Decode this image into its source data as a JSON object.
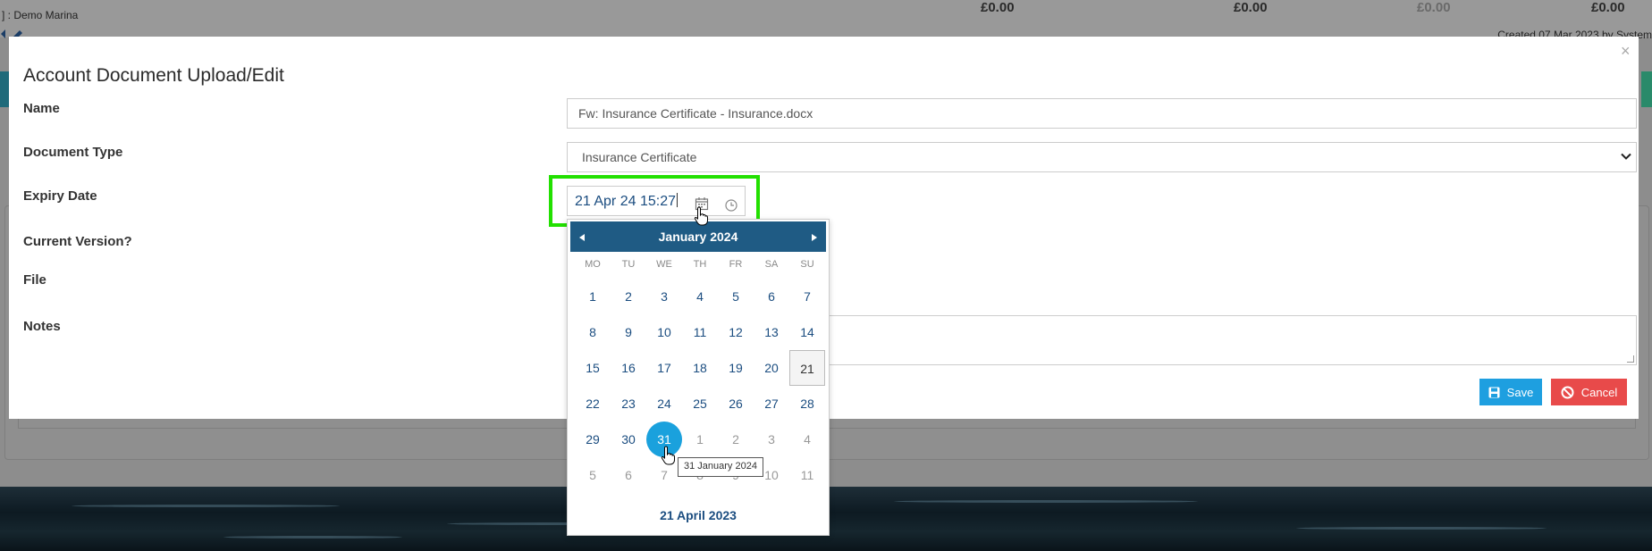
{
  "background": {
    "marina_label": "] : Demo Marina",
    "amounts": [
      "£0.00",
      "£0.00",
      "£0.00",
      "£0.00"
    ],
    "created_text": "Created 07 Mar 2023 by System"
  },
  "modal": {
    "title": "Account Document Upload/Edit",
    "close_symbol": "×",
    "labels": {
      "name": "Name",
      "document_type": "Document Type",
      "expiry_date": "Expiry Date",
      "current_version": "Current Version?",
      "file": "File",
      "notes": "Notes"
    },
    "name_value": "Fw: Insurance Certificate - Insurance.docx",
    "document_type_value": "Insurance Certificate",
    "expiry_value": "21 Apr 24 15:27",
    "save_label": "Save",
    "cancel_label": "Cancel",
    "accent_colors": {
      "save": "#1e9fe0",
      "cancel": "#e84a4a",
      "picker_header": "#1f5b84",
      "selected_day": "#1aa1dd",
      "highlight": "#22e000"
    }
  },
  "datepicker": {
    "month_label": "January 2024",
    "weekdays": [
      "MO",
      "TU",
      "WE",
      "TH",
      "FR",
      "SA",
      "SU"
    ],
    "weeks": [
      [
        {
          "d": "1"
        },
        {
          "d": "2"
        },
        {
          "d": "3"
        },
        {
          "d": "4"
        },
        {
          "d": "5"
        },
        {
          "d": "6"
        },
        {
          "d": "7"
        }
      ],
      [
        {
          "d": "8"
        },
        {
          "d": "9"
        },
        {
          "d": "10"
        },
        {
          "d": "11"
        },
        {
          "d": "12"
        },
        {
          "d": "13"
        },
        {
          "d": "14"
        }
      ],
      [
        {
          "d": "15"
        },
        {
          "d": "16"
        },
        {
          "d": "17"
        },
        {
          "d": "18"
        },
        {
          "d": "19"
        },
        {
          "d": "20"
        },
        {
          "d": "21",
          "state": "today"
        }
      ],
      [
        {
          "d": "22"
        },
        {
          "d": "23"
        },
        {
          "d": "24"
        },
        {
          "d": "25"
        },
        {
          "d": "26"
        },
        {
          "d": "27"
        },
        {
          "d": "28"
        }
      ],
      [
        {
          "d": "29"
        },
        {
          "d": "30"
        },
        {
          "d": "31",
          "state": "selected"
        },
        {
          "d": "1",
          "state": "muted"
        },
        {
          "d": "2",
          "state": "muted"
        },
        {
          "d": "3",
          "state": "muted"
        },
        {
          "d": "4",
          "state": "muted"
        }
      ],
      [
        {
          "d": "5",
          "state": "muted"
        },
        {
          "d": "6",
          "state": "muted"
        },
        {
          "d": "7",
          "state": "muted"
        },
        {
          "d": "8",
          "state": "muted"
        },
        {
          "d": "9",
          "state": "muted"
        },
        {
          "d": "10",
          "state": "muted"
        },
        {
          "d": "11",
          "state": "muted"
        }
      ]
    ],
    "footer_label": "21 April 2023",
    "tooltip": "31 January 2024"
  }
}
